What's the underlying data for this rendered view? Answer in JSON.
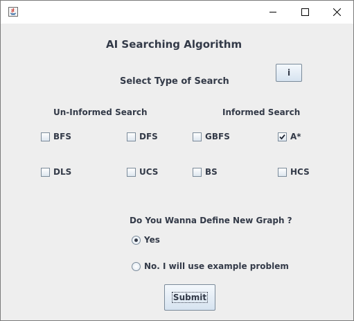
{
  "window": {
    "minimize": "minimize-icon",
    "maximize": "maximize-icon",
    "close": "close-icon"
  },
  "header": {
    "title": "AI Searching Algorithm",
    "subtitle": "Select Type of Search",
    "info_label": "i"
  },
  "uninformed": {
    "heading": "Un-Informed Search",
    "options": [
      {
        "label": "BFS",
        "checked": false
      },
      {
        "label": "DFS",
        "checked": false
      },
      {
        "label": "DLS",
        "checked": false
      },
      {
        "label": "UCS",
        "checked": false
      }
    ]
  },
  "informed": {
    "heading": "Informed Search",
    "options": [
      {
        "label": "GBFS",
        "checked": false
      },
      {
        "label": "A*",
        "checked": true
      },
      {
        "label": "BS",
        "checked": false
      },
      {
        "label": "HCS",
        "checked": false
      }
    ]
  },
  "graph": {
    "question": "Do You Wanna Define New Graph ?",
    "options": [
      {
        "label": "Yes",
        "selected": true
      },
      {
        "label": "No. I will use example problem",
        "selected": false
      }
    ]
  },
  "submit_label": "Submit"
}
